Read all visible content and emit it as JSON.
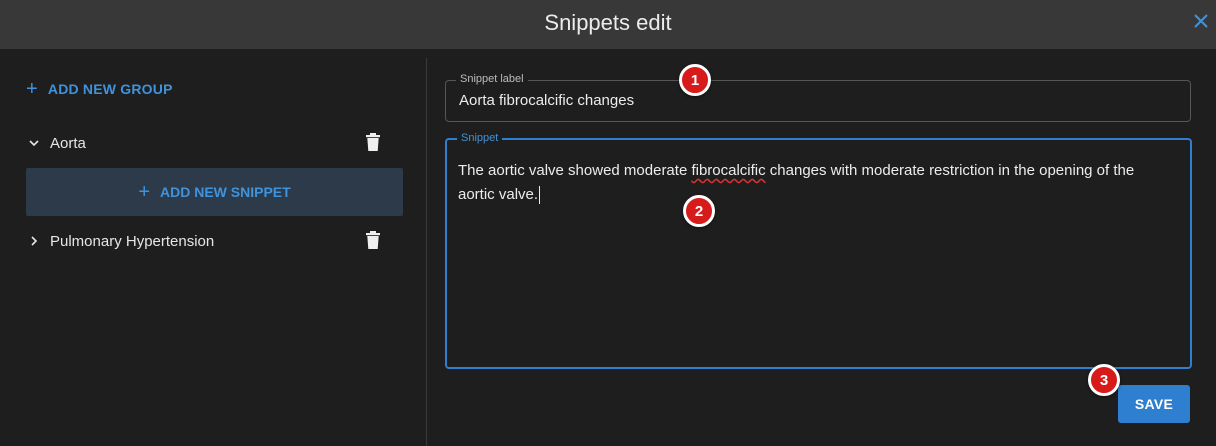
{
  "window": {
    "title": "Snippets edit",
    "close_icon": "close-icon"
  },
  "sidebar": {
    "add_group_label": "ADD NEW GROUP",
    "groups": [
      {
        "label": "Aorta",
        "expanded": true
      },
      {
        "label": "Pulmonary Hypertension",
        "expanded": false
      }
    ],
    "add_snippet_label": "ADD NEW SNIPPET"
  },
  "editor": {
    "label_legend": "Snippet label",
    "label_value": "Aorta fibrocalcific changes",
    "snippet_legend": "Snippet",
    "snippet_before": "The aortic valve showed moderate ",
    "snippet_misspelled": "fibrocalcific",
    "snippet_after": " changes with moderate restriction in the opening of the aortic valve.",
    "save_label": "SAVE"
  },
  "markers": [
    "1",
    "2",
    "3"
  ],
  "colors": {
    "accent": "#3f93dd",
    "marker": "#d71a1a",
    "titlebar": "#383838",
    "background": "#1e1e1e"
  }
}
